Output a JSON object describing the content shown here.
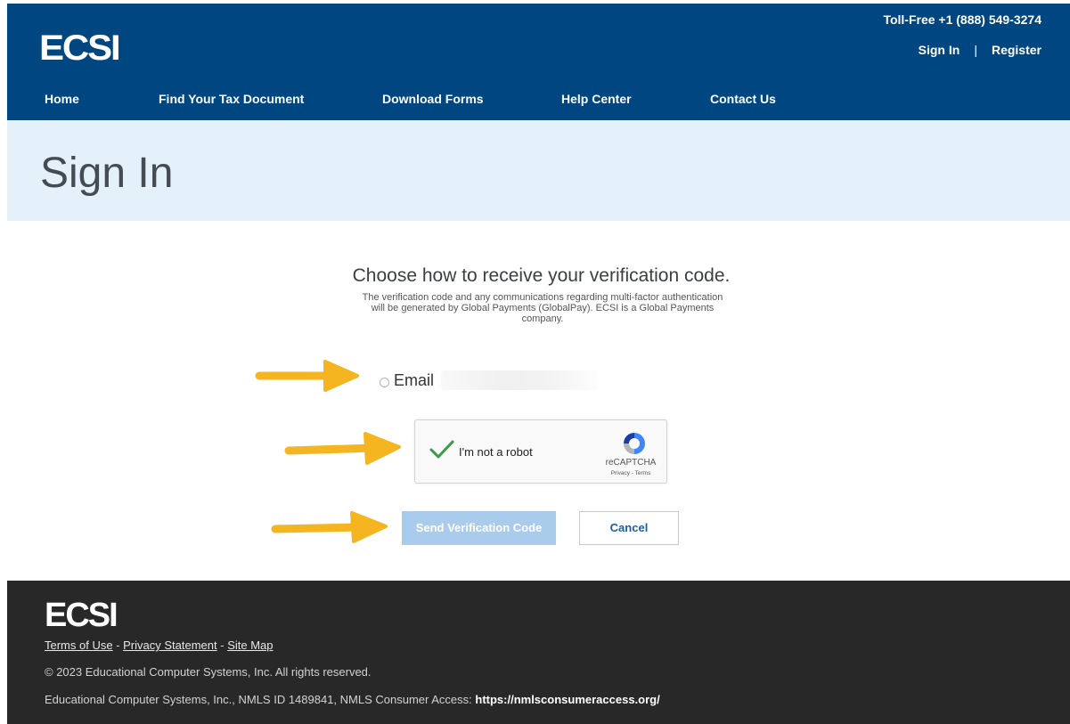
{
  "header": {
    "logo": "ECSI",
    "toll_free": "Toll-Free +1 (888) 549-3274",
    "sign_in": "Sign In",
    "separator": "|",
    "register": "Register",
    "brand_color": "#004680"
  },
  "nav": [
    {
      "label": "Home"
    },
    {
      "label": "Find Your Tax Document"
    },
    {
      "label": "Download Forms"
    },
    {
      "label": "Help Center"
    },
    {
      "label": "Contact Us"
    }
  ],
  "title_band": {
    "title": "Sign In"
  },
  "main": {
    "heading": "Choose how to receive your verification code.",
    "note": "The verification code and any communications regarding multi-factor authentication will be generated by Global Payments (GlobalPay). ECSI is a Global Payments company.",
    "email_option": {
      "label": "Email",
      "selected": false
    },
    "captcha": {
      "label": "I'm not a robot",
      "checked": true,
      "brand": "reCAPTCHA",
      "links": "Privacy - Terms"
    },
    "send_button": "Send Verification Code",
    "cancel_button": "Cancel",
    "annotation_color": "#f5b521"
  },
  "footer": {
    "logo": "ECSI",
    "links": {
      "terms": "Terms of Use",
      "privacy": "Privacy Statement",
      "sitemap": "Site Map",
      "dash": " - "
    },
    "copyright": "© 2023 Educational Computer Systems, Inc. All rights reserved.",
    "nmls_prefix": "Educational Computer Systems, Inc., NMLS ID 1489841, NMLS Consumer Access: ",
    "nmls_url": "https://nmlsconsumeraccess.org/"
  }
}
